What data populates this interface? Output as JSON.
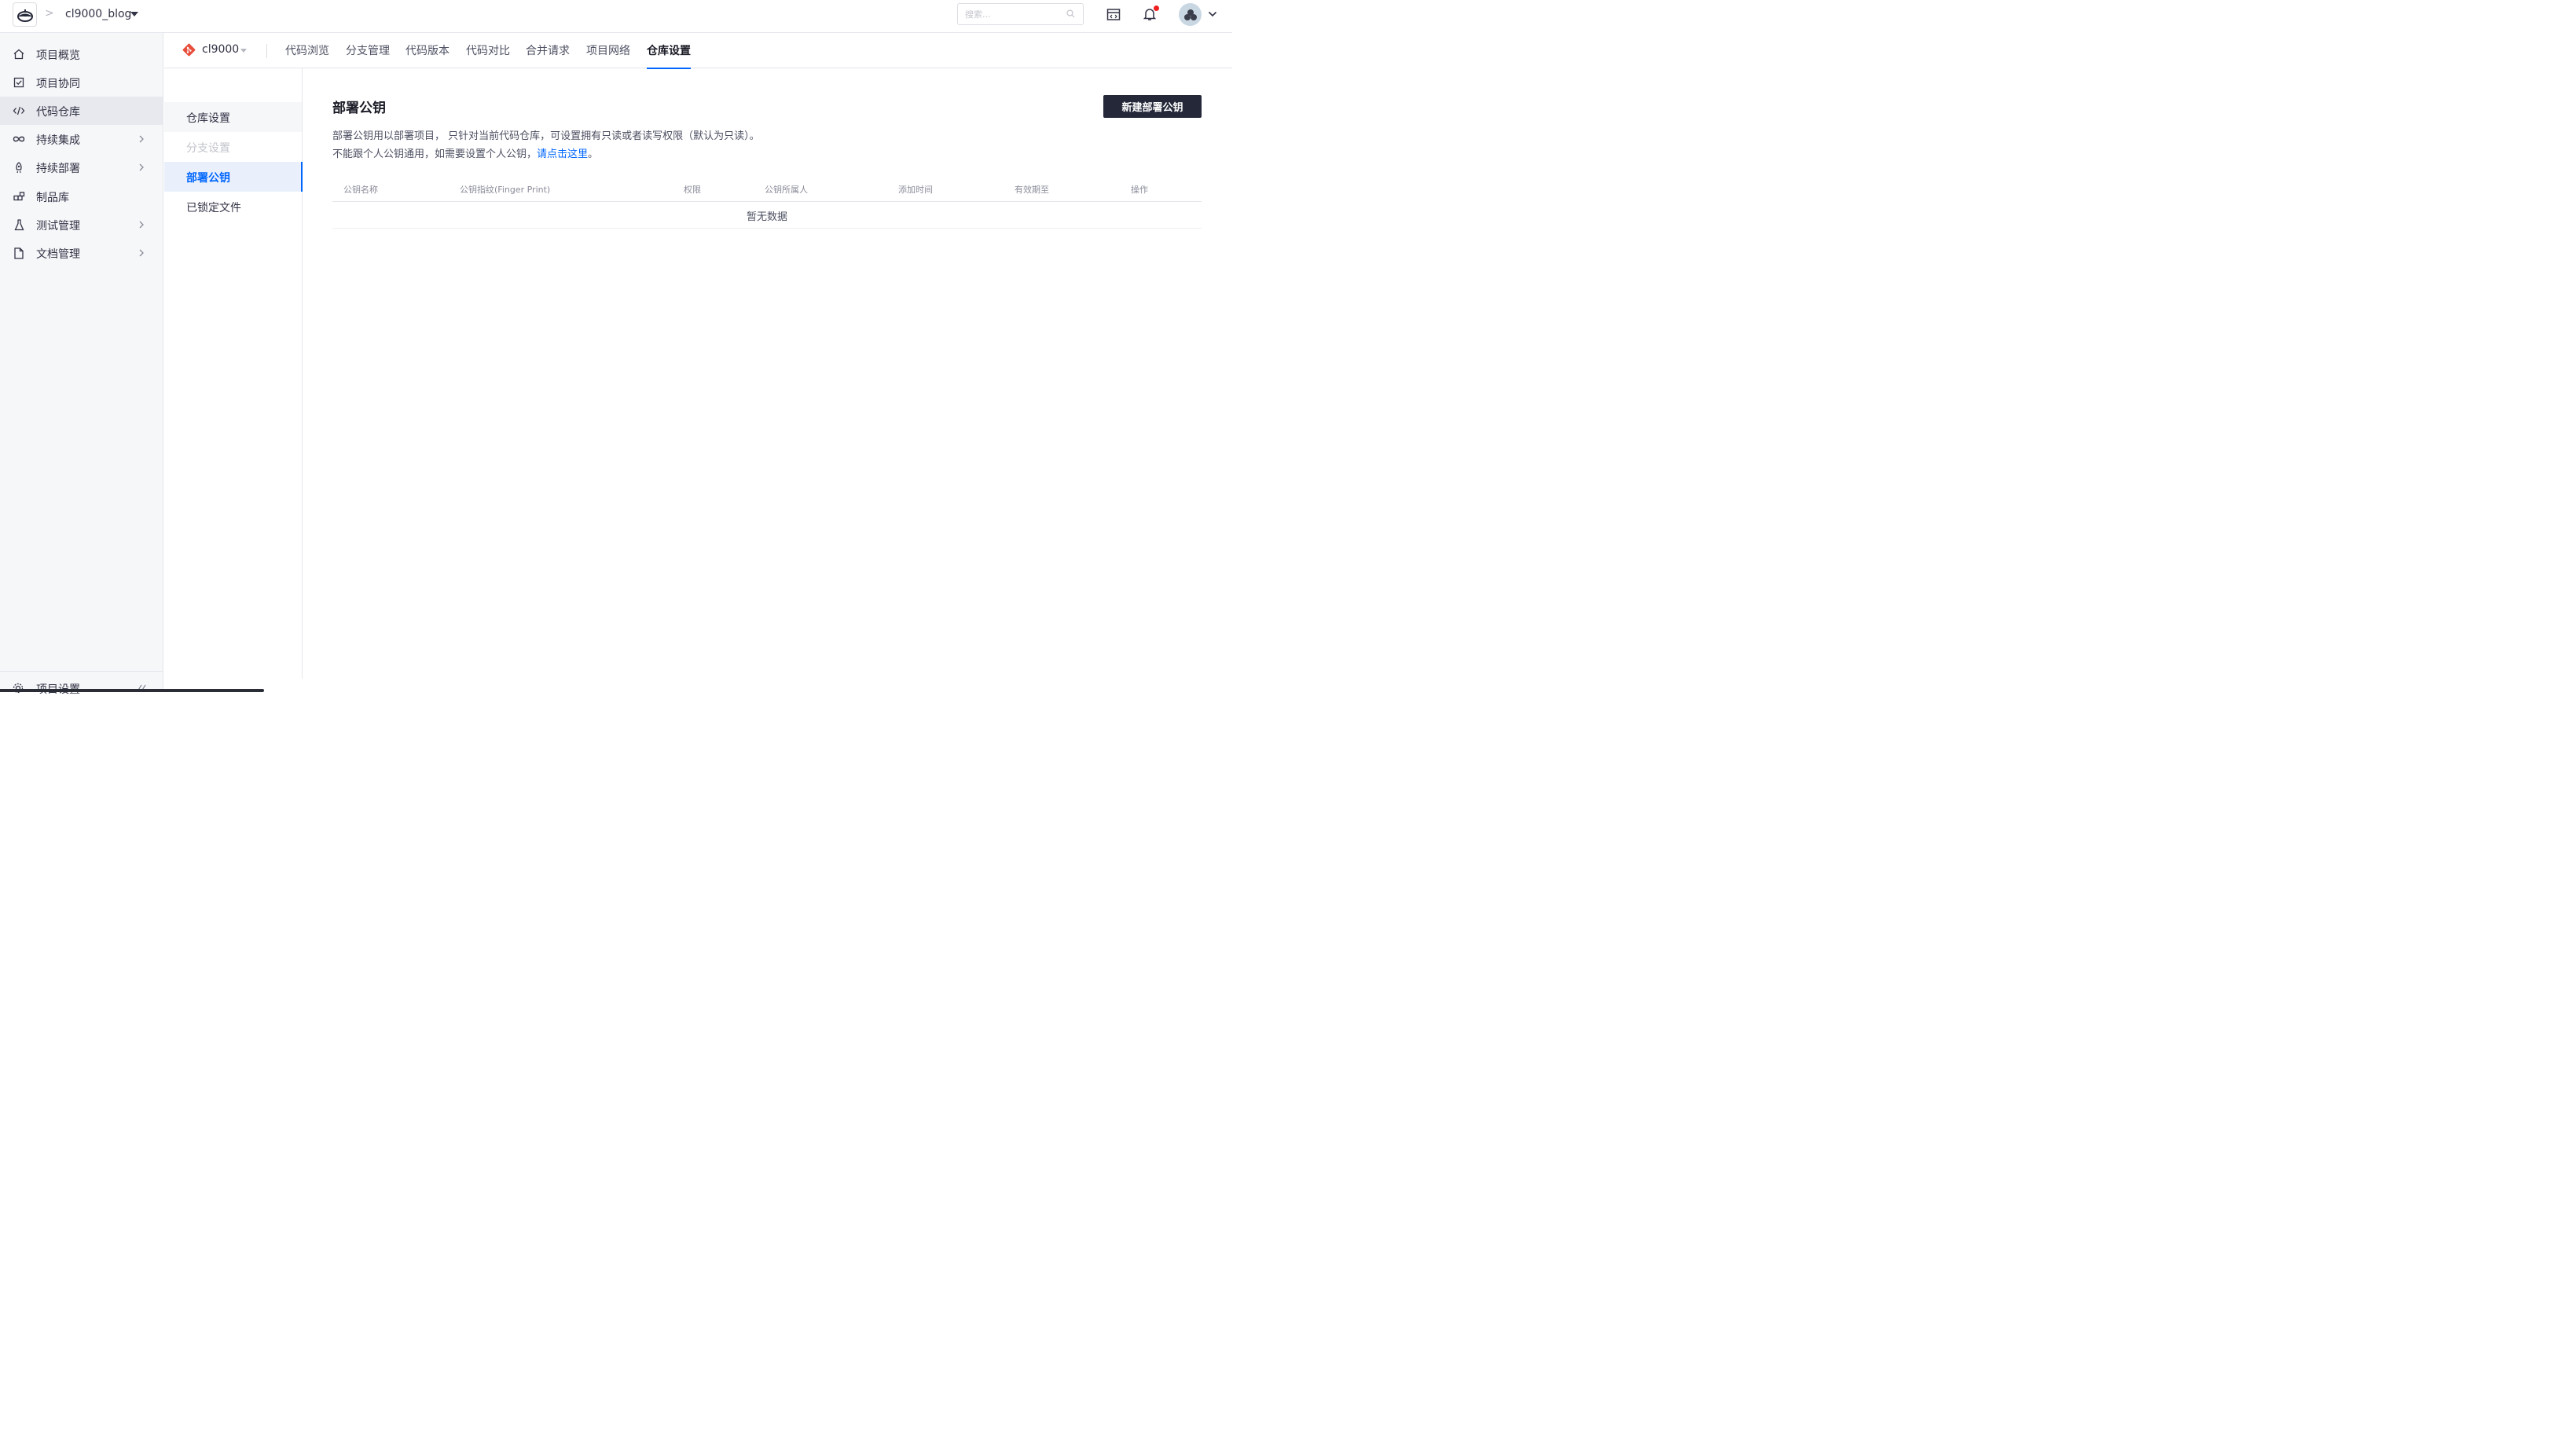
{
  "header": {
    "breadcrumb_separator": ">",
    "project_name": "cl9000_blog",
    "search_placeholder": "搜索...",
    "icons": [
      "logo-icon",
      "search-icon",
      "schedule-icon",
      "bell-icon",
      "avatar",
      "chevron-down-icon"
    ],
    "notification_dot_color": "#f01e1e"
  },
  "sidebar": {
    "items": [
      {
        "label": "项目概览",
        "icon": "home-icon",
        "has_submenu": false,
        "active": false
      },
      {
        "label": "项目协同",
        "icon": "checkbox-icon",
        "has_submenu": false,
        "active": false
      },
      {
        "label": "代码仓库",
        "icon": "code-icon",
        "has_submenu": false,
        "active": true
      },
      {
        "label": "持续集成",
        "icon": "infinity-icon",
        "has_submenu": true,
        "active": false
      },
      {
        "label": "持续部署",
        "icon": "rocket-icon",
        "has_submenu": true,
        "active": false
      },
      {
        "label": "制品库",
        "icon": "artifact-icon",
        "has_submenu": false,
        "active": false
      },
      {
        "label": "测试管理",
        "icon": "flask-icon",
        "has_submenu": true,
        "active": false
      },
      {
        "label": "文档管理",
        "icon": "document-icon",
        "has_submenu": true,
        "active": false
      }
    ],
    "bottom_label": "项目设置"
  },
  "repo": {
    "name": "cl9000",
    "tabs": [
      {
        "label": "代码浏览",
        "active": false
      },
      {
        "label": "分支管理",
        "active": false
      },
      {
        "label": "代码版本",
        "active": false
      },
      {
        "label": "代码对比",
        "active": false
      },
      {
        "label": "合并请求",
        "active": false
      },
      {
        "label": "项目网络",
        "active": false
      },
      {
        "label": "仓库设置",
        "active": true
      }
    ]
  },
  "settings_menu": [
    {
      "label": "仓库设置",
      "state": "normal"
    },
    {
      "label": "分支设置",
      "state": "disabled"
    },
    {
      "label": "部署公钥",
      "state": "selected"
    },
    {
      "label": "已锁定文件",
      "state": "normal"
    }
  ],
  "main": {
    "title": "部署公钥",
    "new_button": "新建部署公钥",
    "desc_line1": "部署公钥用以部署项目， 只针对当前代码仓库，可设置拥有只读或者读写权限（默认为只读）。",
    "desc_line2_prefix": "不能跟个人公钥通用，如需要设置个人公钥，",
    "desc_line2_link": "请点击这里",
    "desc_line2_suffix": "。",
    "columns": [
      "公钥名称",
      "公钥指纹(Finger Print)",
      "权限",
      "公钥所属人",
      "添加时间",
      "有效期至",
      "操作"
    ],
    "empty_text": "暂无数据"
  },
  "colors": {
    "accent": "#0066ff",
    "button_dark": "#242838",
    "sidebar_bg": "#f6f7f9",
    "sidebar_active": "#e7e9ee"
  }
}
